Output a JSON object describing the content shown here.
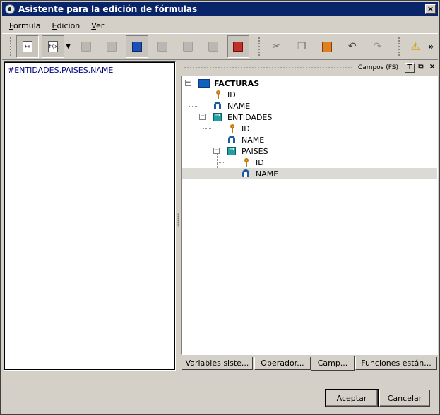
{
  "window": {
    "title": "Asistente para la edición de fórmulas",
    "close_label": "×"
  },
  "menu": {
    "items": [
      {
        "label": "Formula",
        "accel": "F",
        "rest": "ormula"
      },
      {
        "label": "Edicion",
        "accel": "E",
        "rest": "dicion"
      },
      {
        "label": "Ver",
        "accel": "V",
        "rest": "er"
      }
    ]
  },
  "toolbar": {
    "new_formula_text": "+x",
    "function_text": "f(x)",
    "more_label": "»"
  },
  "editor": {
    "text": "#ENTIDADES.PAISES.NAME"
  },
  "dock": {
    "title": "Campos (FS)",
    "pin_label": "⊤",
    "float_label": "⧉",
    "close_label": "×"
  },
  "tree": {
    "root": "FACTURAS",
    "items": [
      {
        "label": "ID",
        "icon": "key-icon"
      },
      {
        "label": "NAME",
        "icon": "field-icon"
      },
      {
        "label": "ENTIDADES",
        "icon": "table-icon"
      },
      {
        "label": "ID",
        "icon": "key-icon"
      },
      {
        "label": "NAME",
        "icon": "field-icon"
      },
      {
        "label": "PAISES",
        "icon": "table-icon"
      },
      {
        "label": "ID",
        "icon": "key-icon"
      },
      {
        "label": "NAME",
        "icon": "field-icon"
      }
    ]
  },
  "tabs": [
    {
      "label": "Variables siste..."
    },
    {
      "label": "Operador..."
    },
    {
      "label": "Camp..."
    },
    {
      "label": "Funciones están..."
    }
  ],
  "buttons": {
    "accept": "Aceptar",
    "cancel": "Cancelar"
  },
  "colors": {
    "titlebar": "#0a246a",
    "window_bg": "#d4d0c8",
    "editor_text": "#000080"
  }
}
